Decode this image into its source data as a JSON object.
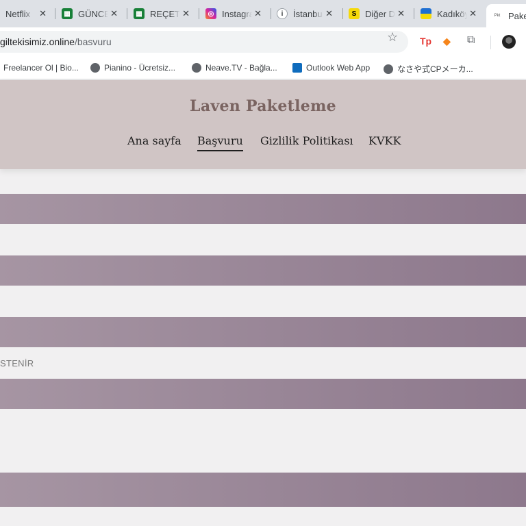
{
  "tabs": [
    {
      "label": "Netflix",
      "icon": "netflix-icon",
      "color": "#dee1e6"
    },
    {
      "label": "GÜNCEL",
      "icon": "sheets-icon",
      "color": "#188038"
    },
    {
      "label": "REÇETE",
      "icon": "sheets-icon",
      "color": "#188038"
    },
    {
      "label": "Instagram",
      "icon": "instagram-icon",
      "color": "#d6249f"
    },
    {
      "label": "İstanbul",
      "icon": "info-icon",
      "color": "#3c4043"
    },
    {
      "label": "Diğer D",
      "icon": "s-icon",
      "color": "#f5d90a"
    },
    {
      "label": "Kadıköy",
      "icon": "flag-icon",
      "color": "#1f6fd1"
    },
    {
      "label": "Paket",
      "icon": "site-favicon",
      "color": "#ffffff"
    }
  ],
  "address_bar": {
    "domain": "giltekisimiz.online",
    "path": "/basvuru"
  },
  "bookmarks": [
    {
      "label": "Freelancer Ol | Bio...",
      "icon": "page-icon"
    },
    {
      "label": "Pianino - Ücretsiz...",
      "icon": "globe-icon"
    },
    {
      "label": "Neave.TV - Bağla...",
      "icon": "globe-icon"
    },
    {
      "label": "Outlook Web App",
      "icon": "outlook-icon"
    },
    {
      "label": "なさや式CPメーカ...",
      "icon": "globe-icon"
    }
  ],
  "site": {
    "title": "Laven Paketleme",
    "nav": [
      "Ana sayfa",
      "Başvuru",
      "Gizlilik Politikası",
      "KVKK"
    ],
    "current_nav": "Başvuru"
  },
  "content": {
    "side_label": "STENİR"
  },
  "colors": {
    "header_bg": "#d0c5c5",
    "title": "#7a6461",
    "bar_start": "#a695a3",
    "bar_end": "#8d788c",
    "page_bg": "#f1f0f1"
  }
}
